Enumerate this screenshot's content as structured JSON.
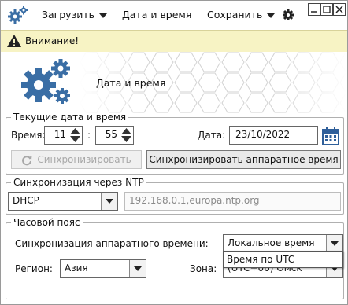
{
  "menu": {
    "load_label": "Загрузить",
    "datetime_label": "Дата и время",
    "save_label": "Сохранить"
  },
  "warning": {
    "text": "Внимание!"
  },
  "banner": {
    "title": "Дата и время"
  },
  "current": {
    "legend": "Текущие дата и время",
    "time_label": "Время:",
    "hours": "11",
    "minutes": "55",
    "separator": ":",
    "date_label": "Дата:",
    "date": "23/10/2022",
    "sync_label": "Синхронизировать",
    "sync_hw_label": "Синхронизировать аппаратное время"
  },
  "ntp": {
    "legend": "Синхронизация через NTP",
    "mode": "DHCP",
    "servers": "192.168.0.1,europa.ntp.org"
  },
  "timezone": {
    "legend": "Часовой пояс",
    "hw_sync_label": "Синхронизация аппаратного времени:",
    "hw_sync_value": "Локальное время",
    "hw_sync_options_visible": [
      "Время по UTC"
    ],
    "region_label": "Регион:",
    "region_value": "Азия",
    "zone_label": "Зона:",
    "zone_value": "(UTC+06) Омск"
  },
  "colors": {
    "warning_bg": "#f7f3c4",
    "icon_blue": "#3a6ea5"
  }
}
